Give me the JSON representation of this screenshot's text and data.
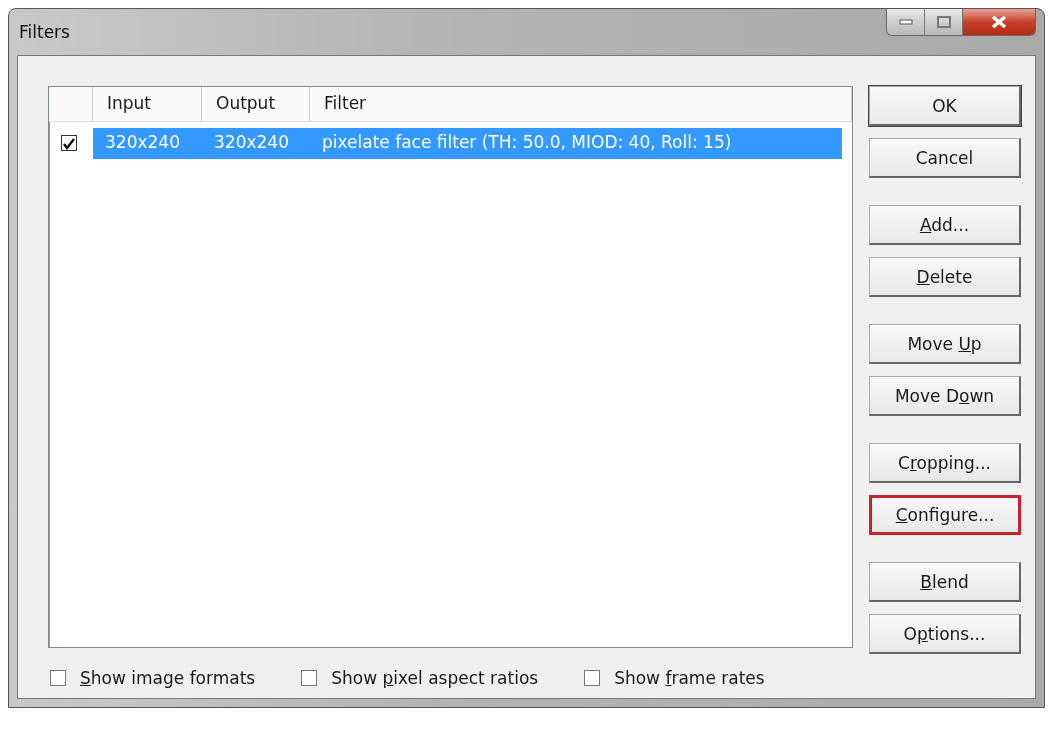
{
  "window": {
    "title": "Filters"
  },
  "table": {
    "columns": [
      {
        "label": "Input"
      },
      {
        "label": "Output"
      },
      {
        "label": "Filter"
      }
    ],
    "rows": [
      {
        "checked": true,
        "selected": true,
        "cells": [
          "320x240",
          "320x240",
          "pixelate face filter (TH: 50.0, MIOD: 40, Roll: 15)"
        ]
      }
    ]
  },
  "button_groups": [
    [
      {
        "before": "OK",
        "default": true,
        "highlighted": false
      },
      {
        "before": "Cancel",
        "default": false,
        "highlighted": false
      }
    ],
    [
      {
        "key": "A",
        "after": "dd...",
        "default": false,
        "highlighted": false
      },
      {
        "key": "D",
        "after": "elete",
        "default": false,
        "highlighted": false
      }
    ],
    [
      {
        "before": "Move ",
        "key": "U",
        "after": "p",
        "default": false,
        "highlighted": false
      },
      {
        "before": "Move D",
        "key": "o",
        "after": "wn",
        "default": false,
        "highlighted": false
      }
    ],
    [
      {
        "before": "C",
        "key": "r",
        "after": "opping...",
        "default": false,
        "highlighted": false
      },
      {
        "key": "C",
        "after": "onfigure...",
        "default": false,
        "highlighted": true
      }
    ],
    [
      {
        "key": "B",
        "after": "lend",
        "default": false,
        "highlighted": false
      },
      {
        "before": "O",
        "key": "p",
        "after": "tions...",
        "default": false,
        "highlighted": false
      }
    ]
  ],
  "options": [
    {
      "key": "S",
      "after": "how image formats",
      "checked": false
    },
    {
      "before": "Show ",
      "key": "p",
      "after": "ixel aspect ratios",
      "checked": false
    },
    {
      "before": "Show ",
      "key": "f",
      "after": "rame rates",
      "checked": false
    }
  ]
}
